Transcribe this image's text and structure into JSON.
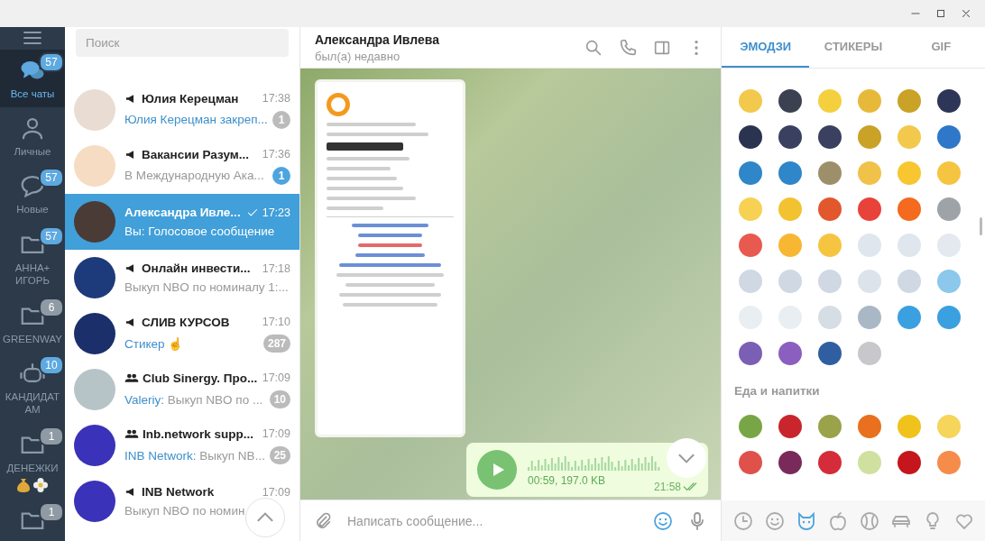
{
  "folders": [
    {
      "kind": "chats",
      "label": "Все чаты",
      "badge": "57",
      "badge_muted": false,
      "selected": true
    },
    {
      "kind": "person",
      "label": "Личные",
      "selected": false
    },
    {
      "kind": "bubble",
      "label": "Новые",
      "badge": "57",
      "badge_muted": false,
      "selected": false
    },
    {
      "kind": "folder",
      "label": "АННА+ ИГОРЬ",
      "badge": "57",
      "badge_muted": false,
      "selected": false
    },
    {
      "kind": "folder",
      "label": "GREENWAY",
      "badge": "6",
      "badge_muted": true,
      "selected": false
    },
    {
      "kind": "bot",
      "label": "КАНДИДАТ АМ",
      "badge": "10",
      "badge_muted": false,
      "selected": false
    },
    {
      "kind": "folder",
      "label": "ДЕНЕЖКИ",
      "badge": "1",
      "badge_muted": true,
      "selected": false,
      "emoji": true
    },
    {
      "kind": "folder",
      "badge": "1",
      "badge_muted": true,
      "selected": false
    }
  ],
  "search": {
    "placeholder": "Поиск"
  },
  "chats": [
    {
      "kind": "channel",
      "name": "Юлия Керецман",
      "time": "17:38",
      "preview": "Юлия Керецман закреп...",
      "preview_accent": true,
      "badge": "1",
      "badge_muted": true,
      "selected": false,
      "read": false
    },
    {
      "kind": "channel",
      "name": "Вакансии Разум...",
      "time": "17:36",
      "preview": "В Международную Ака...",
      "preview_accent": false,
      "badge": "1",
      "badge_muted": false,
      "selected": false,
      "read": false
    },
    {
      "kind": "person",
      "name": "Александра Ивле...",
      "time": "17:23",
      "preview": "Вы: Голосовое сообщение",
      "preview_accent": false,
      "selected": true,
      "read": true
    },
    {
      "kind": "channel",
      "name": "Онлайн инвести...",
      "time": "17:18",
      "preview": "Выкуп NBO по номиналу 1:...",
      "preview_accent": false,
      "selected": false,
      "read": false
    },
    {
      "kind": "channel",
      "name": "СЛИВ КУРСОВ",
      "time": "17:10",
      "preview": "Стикер ☝",
      "preview_accent": true,
      "badge": "287",
      "badge_muted": true,
      "selected": false,
      "read": false
    },
    {
      "kind": "group",
      "name": "Club Sinergy. Про...",
      "time": "17:09",
      "sender": "Valeriy:",
      "preview": "Выкуп NBO по ...",
      "preview_accent": false,
      "badge": "10",
      "badge_muted": true,
      "selected": false,
      "read": false
    },
    {
      "kind": "group",
      "name": "Inb.network supp...",
      "time": "17:09",
      "sender": "INB Network:",
      "preview": "Выкуп NB...",
      "preview_accent": false,
      "badge": "25",
      "badge_muted": true,
      "selected": false,
      "read": false
    },
    {
      "kind": "channel",
      "name": "INB Network",
      "time": "17:09",
      "preview": "Выкуп NBO по номин",
      "preview_accent": false,
      "selected": false,
      "read": false
    }
  ],
  "chat": {
    "title": "Александра Ивлева",
    "status": "был(а) недавно",
    "voice": {
      "meta": "00:59, 197.0 KB",
      "time": "21:58",
      "read": true
    },
    "input": {
      "placeholder": "Написать сообщение..."
    }
  },
  "emoji_panel": {
    "tabs": [
      {
        "label": "ЭМОДЗИ",
        "selected": true
      },
      {
        "label": "СТИКЕРЫ",
        "selected": false
      },
      {
        "label": "GIF",
        "selected": false
      }
    ],
    "section": "Еда и напитки",
    "categories": [
      {
        "kind": "recent",
        "selected": false
      },
      {
        "kind": "smile",
        "selected": false
      },
      {
        "kind": "cat",
        "selected": true
      },
      {
        "kind": "apple",
        "selected": false
      },
      {
        "kind": "ball",
        "selected": false
      },
      {
        "kind": "car",
        "selected": false
      },
      {
        "kind": "bulb",
        "selected": false
      },
      {
        "kind": "heart",
        "selected": false
      }
    ]
  }
}
